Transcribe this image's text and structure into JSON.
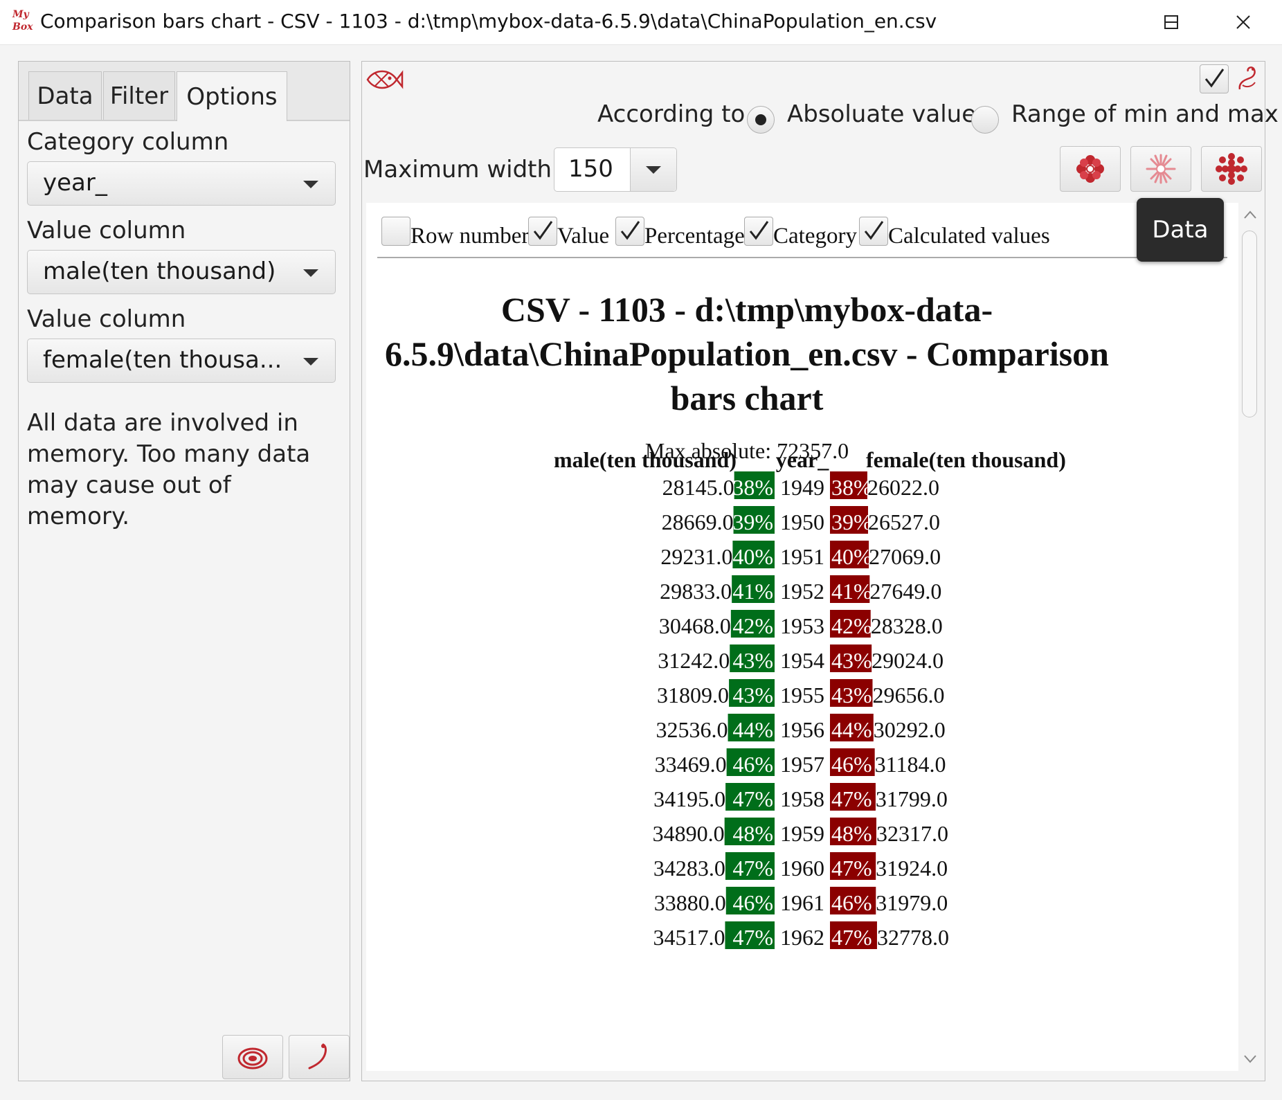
{
  "window": {
    "title": "Comparison bars chart - CSV - 1103 - d:\\tmp\\mybox-data-6.5.9\\data\\ChinaPopulation_en.csv",
    "logo_text": "My Box"
  },
  "left": {
    "tabs": [
      "Data",
      "Filter",
      "Options"
    ],
    "active_tab": "Options",
    "category_label": "Category column",
    "category_value": "year_",
    "value1_label": "Value column",
    "value1_value": "male(ten thousand)",
    "value2_label": "Value column",
    "value2_value": "female(ten thousa...",
    "note": "All data are involved in memory. Too many data may cause out of memory."
  },
  "options": {
    "according_label": "According to",
    "radio_absolute": "Absoluate value",
    "radio_range": "Range of min and max",
    "selected_radio": "absolute",
    "max_width_label": "Maximum width",
    "max_width_value": "150",
    "top_checkbox_checked": true
  },
  "tooltip": {
    "text": "Data"
  },
  "view": {
    "checkboxes": [
      {
        "label": "Row number",
        "checked": false
      },
      {
        "label": "Value",
        "checked": true
      },
      {
        "label": "Percentage",
        "checked": true
      },
      {
        "label": "Category",
        "checked": true
      },
      {
        "label": "Calculated values",
        "checked": true
      }
    ],
    "doc_title": "CSV - 1103 - d:\\tmp\\mybox-data-6.5.9\\data\\ChinaPopulation_en.csv - Comparison bars chart",
    "max_absolute": "Max absolute: 72357.0"
  },
  "colors": {
    "male_bar": "#006e1a",
    "female_bar": "#8b0000",
    "accent": "#c0282f"
  },
  "chart_data": {
    "type": "bar",
    "max_absolute": 72357.0,
    "headers": {
      "left": "male(ten thousand)",
      "category": "year_",
      "right": "female(ten thousand)"
    },
    "categories": [
      "1949",
      "1950",
      "1951",
      "1952",
      "1953",
      "1954",
      "1955",
      "1956",
      "1957",
      "1958",
      "1959",
      "1960",
      "1961",
      "1962"
    ],
    "series": [
      {
        "name": "male(ten thousand)",
        "values": [
          "28145.0",
          "28669.0",
          "29231.0",
          "29833.0",
          "30468.0",
          "31242.0",
          "31809.0",
          "32536.0",
          "33469.0",
          "34195.0",
          "34890.0",
          "34283.0",
          "33880.0",
          "34517.0"
        ],
        "percent": [
          "38%",
          "39%",
          "40%",
          "41%",
          "42%",
          "43%",
          "43%",
          "44%",
          "46%",
          "47%",
          "48%",
          "47%",
          "46%",
          "47%"
        ]
      },
      {
        "name": "female(ten thousand)",
        "values": [
          "26022.0",
          "26527.0",
          "27069.0",
          "27649.0",
          "28328.0",
          "29024.0",
          "29656.0",
          "30292.0",
          "31184.0",
          "31799.0",
          "32317.0",
          "31924.0",
          "31979.0",
          "32778.0"
        ],
        "percent": [
          "38%",
          "39%",
          "40%",
          "41%",
          "42%",
          "43%",
          "43%",
          "44%",
          "46%",
          "47%",
          "48%",
          "47%",
          "46%",
          "47%"
        ]
      }
    ]
  }
}
